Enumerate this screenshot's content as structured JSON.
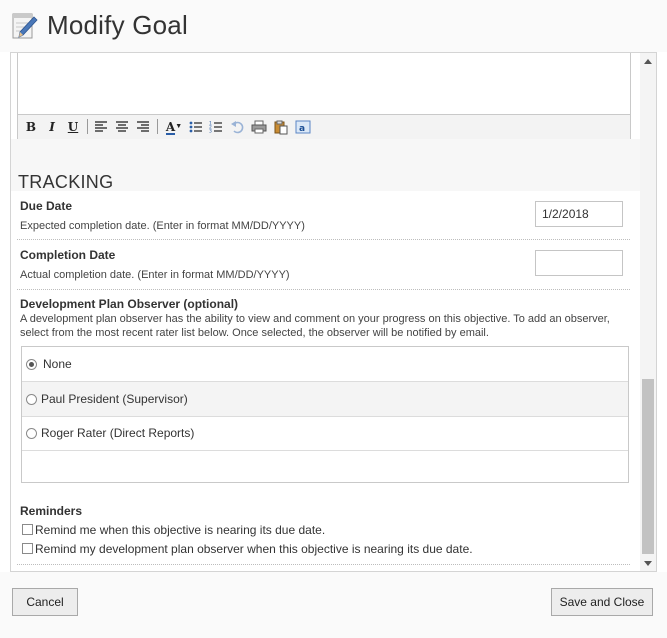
{
  "dialog": {
    "title": "Modify Goal",
    "title_icon": "notepad-pencil-icon"
  },
  "editor": {
    "toolbar": [
      {
        "name": "bold-button",
        "glyph": "B"
      },
      {
        "name": "italic-button",
        "glyph": "I"
      },
      {
        "name": "underline-button",
        "glyph": "U"
      },
      {
        "name": "align-left-icon"
      },
      {
        "name": "align-center-icon"
      },
      {
        "name": "align-right-icon"
      },
      {
        "name": "font-color-button",
        "glyph": "A"
      },
      {
        "name": "bullet-list-icon"
      },
      {
        "name": "numbered-list-icon"
      },
      {
        "name": "undo-icon"
      },
      {
        "name": "print-icon"
      },
      {
        "name": "paste-icon"
      },
      {
        "name": "spellcheck-icon"
      }
    ]
  },
  "tracking": {
    "heading": "TRACKING",
    "due_date": {
      "label": "Due Date",
      "hint": "Expected completion date.  (Enter in format MM/DD/YYYY)",
      "value": "1/2/2018"
    },
    "completion_date": {
      "label": "Completion Date",
      "hint": "Actual completion date.  (Enter in format MM/DD/YYYY)",
      "value": ""
    },
    "observer": {
      "label": "Development Plan Observer (optional)",
      "description": "A development plan observer has the ability to view and comment on your progress on this objective. To add an observer, select from the most recent rater list below. Once selected, the observer will be notified by email.",
      "options": [
        {
          "label": "None",
          "checked": true
        },
        {
          "label": "Paul President (Supervisor)",
          "checked": false
        },
        {
          "label": "Roger Rater (Direct Reports)",
          "checked": false
        }
      ]
    },
    "reminders": {
      "label": "Reminders",
      "items": [
        {
          "label": "Remind me when this objective is nearing its due date.",
          "checked": false
        },
        {
          "label": "Remind my development plan observer when this objective is nearing its due date.",
          "checked": false
        }
      ]
    }
  },
  "footer": {
    "cancel_label": "Cancel",
    "save_label": "Save and Close"
  }
}
